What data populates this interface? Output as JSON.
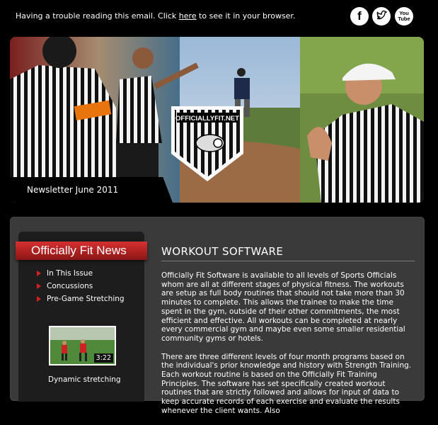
{
  "topbar": {
    "trouble_prefix": "Having a trouble reading this email. Click ",
    "trouble_link": "here",
    "trouble_suffix": " to see it in your browser.",
    "social": [
      "facebook-icon",
      "twitter-icon",
      "youtube-icon"
    ],
    "facebook_glyph": "f",
    "youtube_label": "You Tube"
  },
  "hero": {
    "logo_text": "OFFICIALLYFIT.NET",
    "caption": "Newsletter June 2011"
  },
  "sidebar": {
    "header": "Officially Fit News",
    "items": [
      {
        "label": "In This Issue"
      },
      {
        "label": "Concussions"
      },
      {
        "label": "Pre-Game Stretching"
      }
    ],
    "video": {
      "duration": "3:22",
      "caption": "Dynamic stretching"
    }
  },
  "article": {
    "title": "WORKOUT SOFTWARE",
    "paragraphs": [
      "Officially Fit Software is available to all levels of Sports Officials whom are all at different stages of physical fitness. The workouts are setup as full body routines that should not take more than 30 minutes to complete. This allows the trainee to make the time spent in the gym, outside of their other commitments, the most efficient and effective. All workouts can be completed at nearly every commercial gym and maybe even some smaller residential community gyms or hotels.",
      "There are three different levels of four month programs based on the individual's prior knowledge and history with Strength Training. Each workout routine is based on the Officially Fit Training Principles. The software has set specifically created workout routines that are strictly followed and allows for input of data to keep accurate records of each exercise and evaluate the results whenever the client wants. Also"
    ]
  },
  "colors": {
    "accent_red": "#c82020",
    "background": "#000000",
    "panel": "#3a3a3a"
  }
}
